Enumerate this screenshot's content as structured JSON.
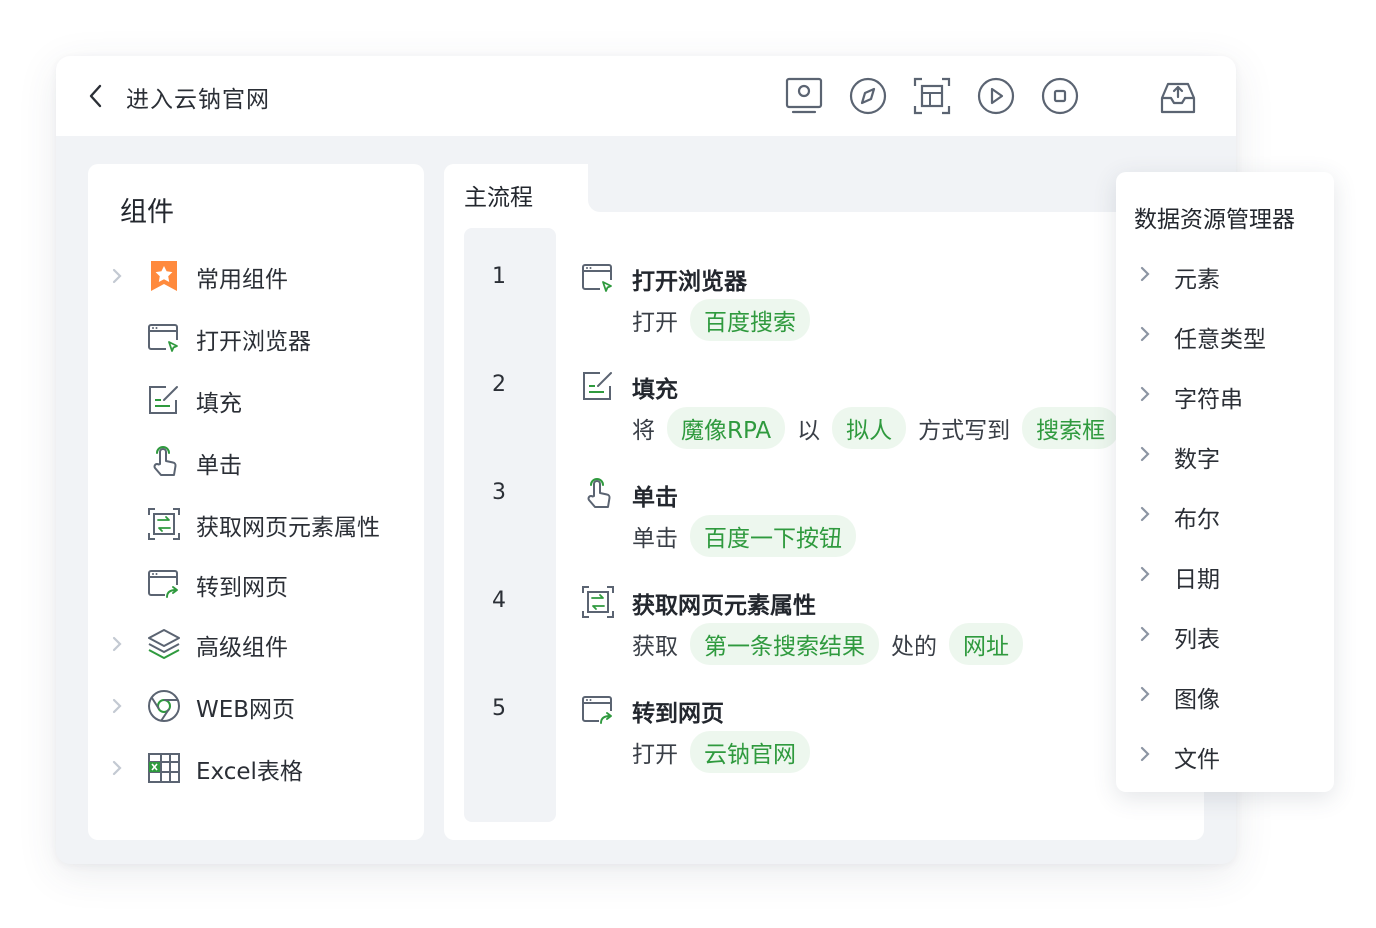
{
  "window": {
    "title": "进入云钠官网"
  },
  "toolbar": {
    "icons": [
      "screen-capture-icon",
      "compass-icon",
      "frame-select-icon",
      "play-icon",
      "stop-icon",
      "publish-upload-icon"
    ]
  },
  "components": {
    "title": "组件",
    "items": [
      {
        "label": "常用组件",
        "expandable": true,
        "icon": "star-badge-icon"
      },
      {
        "label": "打开浏览器",
        "expandable": false,
        "icon": "browser-open-icon"
      },
      {
        "label": "填充",
        "expandable": false,
        "icon": "fill-icon"
      },
      {
        "label": "单击",
        "expandable": false,
        "icon": "click-hand-icon"
      },
      {
        "label": "获取网页元素属性",
        "expandable": false,
        "icon": "get-element-icon"
      },
      {
        "label": "转到网页",
        "expandable": false,
        "icon": "goto-page-icon"
      },
      {
        "label": "高级组件",
        "expandable": true,
        "icon": "layers-icon"
      },
      {
        "label": "WEB网页",
        "expandable": true,
        "icon": "chrome-icon"
      },
      {
        "label": "Excel表格",
        "expandable": true,
        "icon": "excel-icon"
      }
    ]
  },
  "flow": {
    "tab": "主流程",
    "steps": [
      {
        "num": "1",
        "name": "打开浏览器",
        "parts": [
          {
            "t": "打开"
          },
          {
            "chip": "百度搜索"
          }
        ]
      },
      {
        "num": "2",
        "name": "填充",
        "parts": [
          {
            "t": "将"
          },
          {
            "chip": "魔像RPA"
          },
          {
            "t": "以"
          },
          {
            "chip": "拟人"
          },
          {
            "t": "方式写到"
          },
          {
            "chip": "搜索框"
          }
        ]
      },
      {
        "num": "3",
        "name": "单击",
        "parts": [
          {
            "t": "单击"
          },
          {
            "chip": "百度一下按钮"
          }
        ]
      },
      {
        "num": "4",
        "name": "获取网页元素属性",
        "parts": [
          {
            "t": "获取"
          },
          {
            "chip": "第一条搜索结果"
          },
          {
            "t": "处的"
          },
          {
            "chip": "网址"
          }
        ]
      },
      {
        "num": "5",
        "name": "转到网页",
        "parts": [
          {
            "t": "打开"
          },
          {
            "chip": "云钠官网"
          }
        ]
      }
    ]
  },
  "data_manager": {
    "title": "数据资源管理器",
    "items": [
      "元素",
      "任意类型",
      "字符串",
      "数字",
      "布尔",
      "日期",
      "列表",
      "图像",
      "文件"
    ]
  },
  "colors": {
    "accent_green": "#2f9a3e",
    "chip_bg": "#edf7ee",
    "icon_gray": "#5b6472",
    "star_orange": "#ff8a3d"
  }
}
